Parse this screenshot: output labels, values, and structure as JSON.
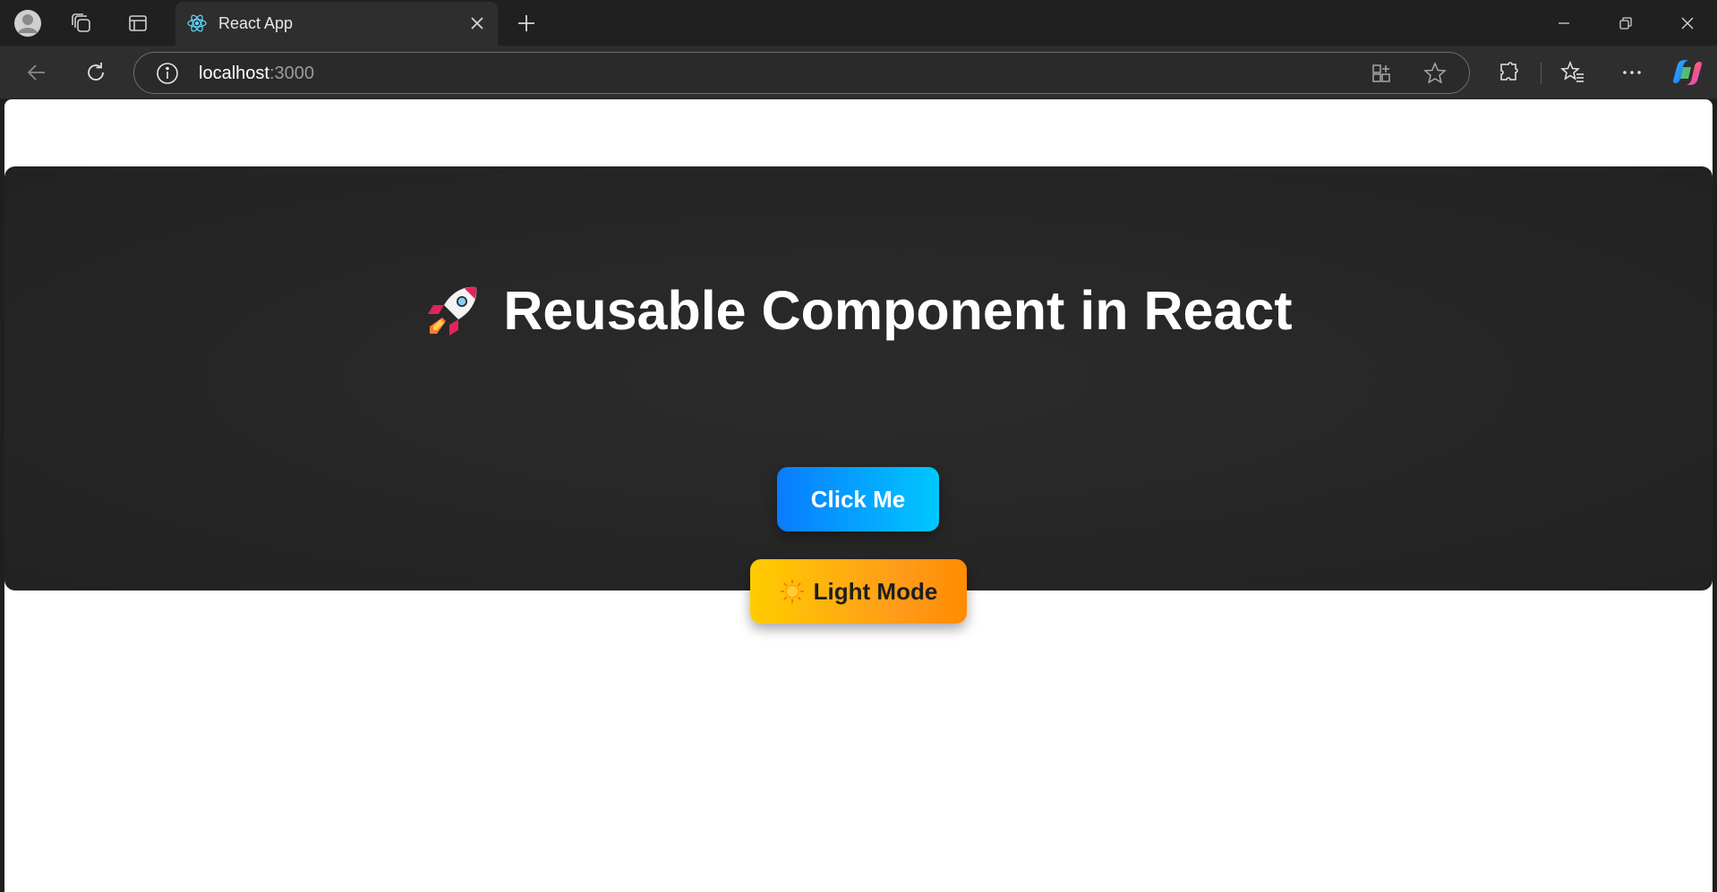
{
  "browser": {
    "tab": {
      "title": "React App"
    },
    "address": {
      "host": "localhost",
      "port": ":3000"
    }
  },
  "page": {
    "heading": "Reusable Component in React",
    "heading_emoji": "rocket",
    "primary_button": "Click Me",
    "mode_button": "Light Mode",
    "mode_icon": "sun"
  },
  "colors": {
    "hero_background": "#262626",
    "primary_gradient": [
      "#0a7bff",
      "#00c8ff"
    ],
    "mode_gradient": [
      "#ffcc00",
      "#ff8c00"
    ]
  }
}
